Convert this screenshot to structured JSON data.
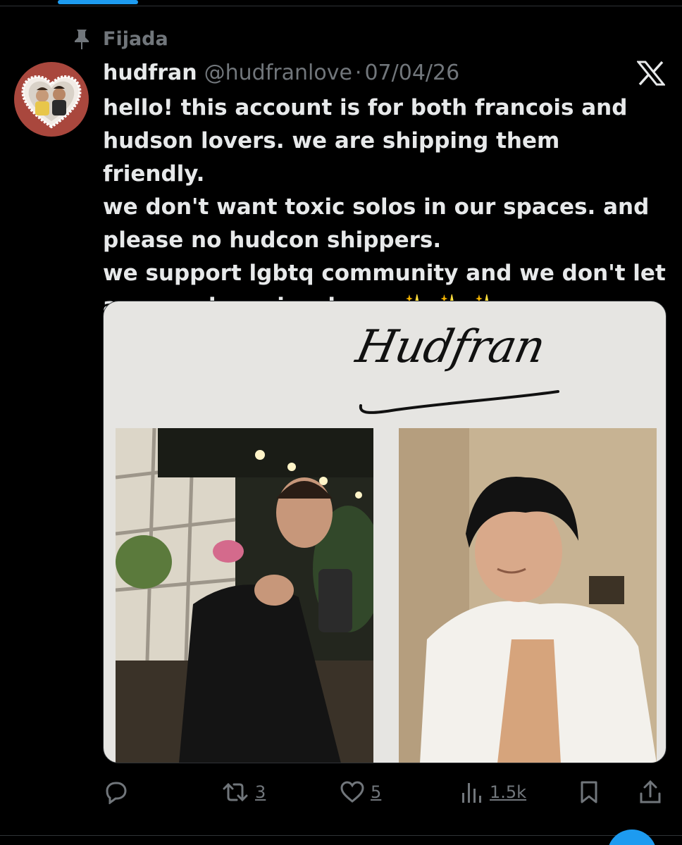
{
  "pinned": {
    "label": "Fijada",
    "icon": "pin-icon"
  },
  "tweet": {
    "display_name": "hudfran",
    "handle": "@hudfranlove",
    "separator": "·",
    "date": "07/04/26",
    "text": "hello! this account is for both francois and\nhudson lovers. we are shipping them friendly.\nwe don't want toxic solos in our spaces. and\nplease no hudcon shippers.\nwe support lgbtq community and we don't let\nanyone do racism here. ✨ ✨ ✨",
    "avatar_icon": "avatar",
    "logo_icon": "x-logo-icon"
  },
  "media": {
    "title": "Hudfran"
  },
  "actions": {
    "reply": {
      "icon": "reply-icon",
      "count": ""
    },
    "repost": {
      "icon": "repost-icon",
      "count": "3"
    },
    "like": {
      "icon": "heart-icon",
      "count": "5"
    },
    "views": {
      "icon": "views-icon",
      "count": "1.5k"
    },
    "bookmark": {
      "icon": "bookmark-icon"
    },
    "share": {
      "icon": "share-icon"
    }
  },
  "colors": {
    "background": "#000000",
    "text_primary": "#e7e9ea",
    "text_secondary": "#71767b",
    "accent": "#1d9bf0",
    "divider": "#2f3336"
  }
}
